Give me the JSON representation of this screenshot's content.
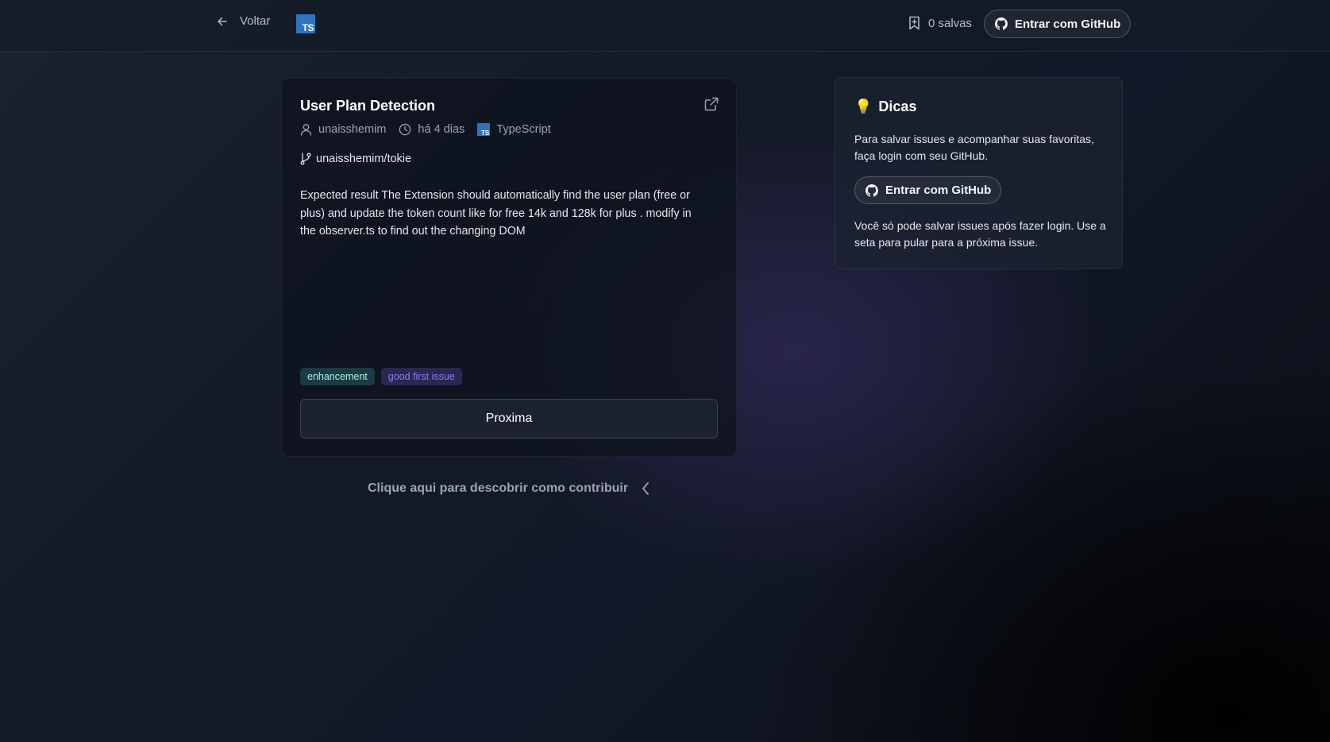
{
  "header": {
    "back_label": "Voltar",
    "logo_text": "TS",
    "saved_label": "0 salvas",
    "github_button": "Entrar com GitHub"
  },
  "issue": {
    "title": "User Plan Detection",
    "author": "unaisshemim",
    "time_ago": "há 4 dias",
    "language": "TypeScript",
    "language_badge": "TS",
    "repo": "unaisshemim/tokie",
    "body": "Expected result The Extension should automatically find the user plan (free or plus) and update the token count like for free 14k and 128k for plus . modify in the observer.ts to find out the changing DOM",
    "labels": [
      "enhancement",
      "good first issue"
    ],
    "next_button": "Proxima"
  },
  "contribute_link": "Clique aqui para descobrir como contribuir",
  "tips": {
    "icon": "💡",
    "title": "Dicas",
    "text1": "Para salvar issues e acompanhar suas favoritas, faça login com seu GitHub.",
    "github_button": "Entrar com GitHub",
    "text2": "Você só pode salvar issues após fazer login. Use a seta para pular para a próxima issue."
  },
  "colors": {
    "label_enhancement_bg": "#1c3a42",
    "label_gfi_bg": "#2a2750",
    "typescript_blue": "#2f74c0"
  }
}
